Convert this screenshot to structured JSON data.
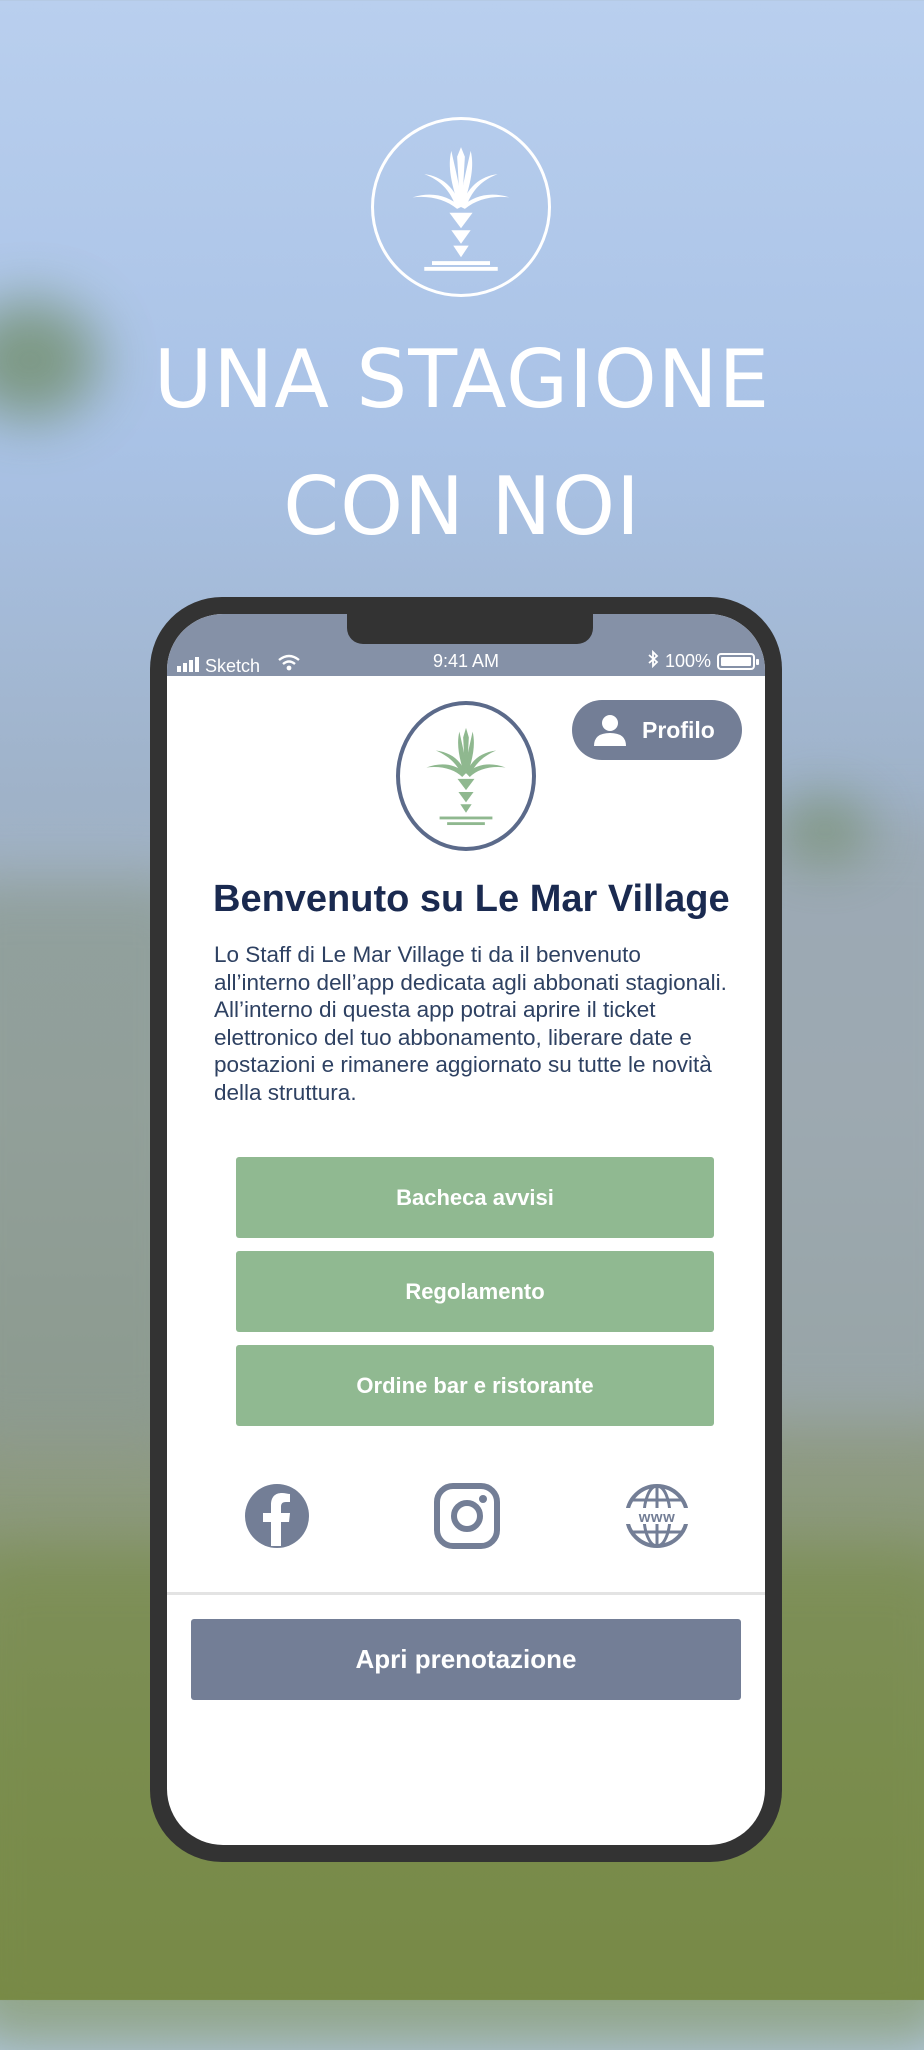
{
  "promo": {
    "headline_line1": "UNA STAGIONE",
    "headline_line2": "CON NOI",
    "logo_icon": "palm-tree-logo-icon"
  },
  "status_bar": {
    "carrier": "Sketch",
    "time": "9:41 AM",
    "battery": "100%"
  },
  "header": {
    "profile_label": "Profilo",
    "profile_icon": "user-icon"
  },
  "content": {
    "title": "Benvenuto su Le Mar Village",
    "intro": "Lo Staff di Le Mar Village ti da il benvenuto all’interno dell’app dedicata agli abbonati stagionali. All’interno di questa app potrai aprire il ticket elettronico del tuo abbonamento, liberare date e postazioni e rimanere aggiornato su tutte le novità della struttura."
  },
  "menu": {
    "items": [
      {
        "label": "Bacheca avvisi"
      },
      {
        "label": "Regolamento"
      },
      {
        "label": "Ordine bar e ristorante"
      }
    ]
  },
  "social": {
    "icons": [
      "facebook-icon",
      "instagram-icon",
      "website-icon"
    ]
  },
  "footer": {
    "cta_label": "Apri prenotazione"
  },
  "colors": {
    "accent_green": "#90b991",
    "slate": "#737e96",
    "title_navy": "#1a2a50"
  }
}
